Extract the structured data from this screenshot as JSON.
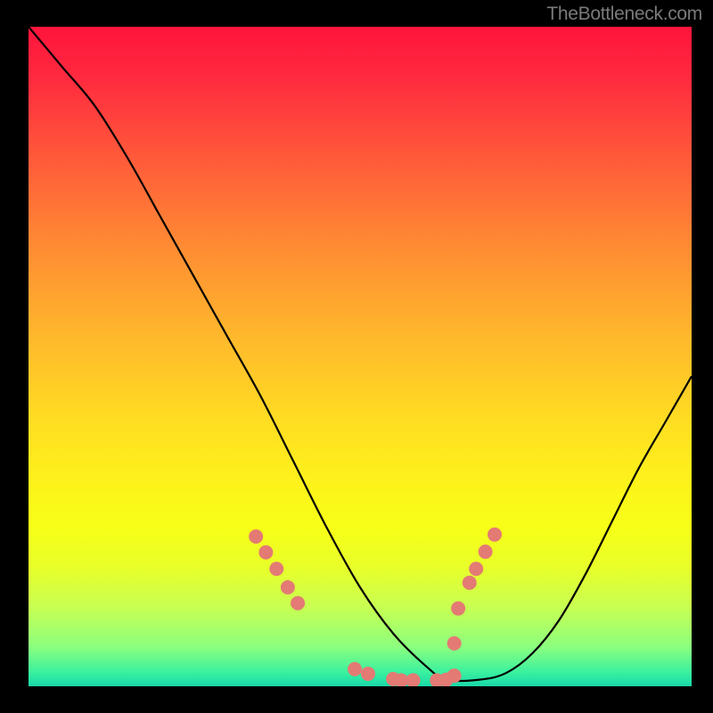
{
  "watermark": "TheBottleneck.com",
  "chart_data": {
    "type": "line",
    "title": "",
    "xlabel": "",
    "ylabel": "",
    "xlim": [
      0,
      100
    ],
    "ylim": [
      0,
      100
    ],
    "gradient_stops": [
      {
        "pct": 0,
        "color": "#ff143c"
      },
      {
        "pct": 8,
        "color": "#ff2b3f"
      },
      {
        "pct": 20,
        "color": "#ff5a3a"
      },
      {
        "pct": 33,
        "color": "#ff8a33"
      },
      {
        "pct": 47,
        "color": "#ffb82c"
      },
      {
        "pct": 60,
        "color": "#ffde22"
      },
      {
        "pct": 70,
        "color": "#fdf41a"
      },
      {
        "pct": 76,
        "color": "#f7ff18"
      },
      {
        "pct": 82,
        "color": "#e8ff2a"
      },
      {
        "pct": 88,
        "color": "#c8ff52"
      },
      {
        "pct": 94,
        "color": "#8cff7e"
      },
      {
        "pct": 98,
        "color": "#38f0a0"
      },
      {
        "pct": 100,
        "color": "#18d8a8"
      }
    ],
    "series": [
      {
        "name": "bottleneck-curve",
        "x": [
          0,
          5,
          10,
          15,
          20,
          25,
          30,
          35,
          40,
          45,
          50,
          55,
          60,
          63,
          68,
          72,
          76,
          80,
          84,
          88,
          92,
          96,
          100
        ],
        "values": [
          100,
          94,
          88,
          80,
          71,
          62,
          53,
          44,
          34,
          24,
          15,
          8,
          3,
          1,
          1,
          2,
          5,
          10,
          17,
          25,
          33,
          40,
          47
        ]
      }
    ],
    "highlight_points": {
      "color": "#e47a74",
      "radius": 8,
      "points": [
        {
          "x": 34.3,
          "y": 22.7
        },
        {
          "x": 35.8,
          "y": 20.3
        },
        {
          "x": 37.4,
          "y": 17.8
        },
        {
          "x": 39.1,
          "y": 15.0
        },
        {
          "x": 40.6,
          "y": 12.6
        },
        {
          "x": 49.2,
          "y": 2.6
        },
        {
          "x": 51.2,
          "y": 1.9
        },
        {
          "x": 55.0,
          "y": 1.1
        },
        {
          "x": 56.2,
          "y": 0.9
        },
        {
          "x": 58.0,
          "y": 0.9
        },
        {
          "x": 61.6,
          "y": 0.9
        },
        {
          "x": 63.0,
          "y": 1.0
        },
        {
          "x": 64.2,
          "y": 1.6
        },
        {
          "x": 64.2,
          "y": 6.5
        },
        {
          "x": 64.8,
          "y": 11.8
        },
        {
          "x": 66.5,
          "y": 15.7
        },
        {
          "x": 67.5,
          "y": 17.8
        },
        {
          "x": 68.9,
          "y": 20.4
        },
        {
          "x": 70.3,
          "y": 23.0
        }
      ]
    }
  }
}
